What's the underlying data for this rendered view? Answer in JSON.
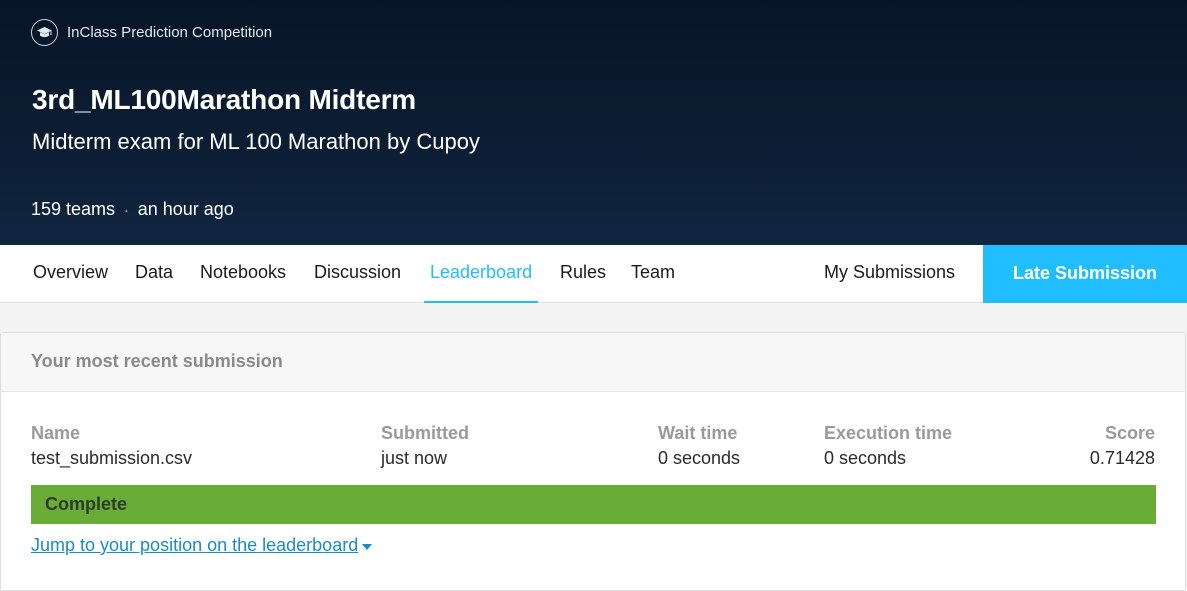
{
  "header": {
    "competition_type": "InClass Prediction Competition",
    "title": "3rd_ML100Marathon Midterm",
    "subtitle": "Midterm exam for ML 100 Marathon by Cupoy",
    "teams": "159 teams",
    "separator": "·",
    "updated": "an hour ago",
    "icon": "graduation-cap-icon"
  },
  "tabs": {
    "overview": "Overview",
    "data": "Data",
    "notebooks": "Notebooks",
    "discussion": "Discussion",
    "leaderboard": "Leaderboard",
    "rules": "Rules",
    "team": "Team",
    "active": "Leaderboard"
  },
  "actions": {
    "my_submissions": "My Submissions",
    "late_submission": "Late Submission"
  },
  "submission": {
    "heading": "Your most recent submission",
    "columns": {
      "name": "Name",
      "submitted": "Submitted",
      "wait_time": "Wait time",
      "execution_time": "Execution time",
      "score": "Score"
    },
    "values": {
      "name": "test_submission.csv",
      "submitted": "just now",
      "wait_time": "0 seconds",
      "execution_time": "0 seconds",
      "score": "0.71428"
    },
    "status": "Complete",
    "jump_link": "Jump to your position on the leaderboard"
  },
  "colors": {
    "header_bg": "#0c1d33",
    "accent": "#20beff",
    "complete_green": "#6aad36",
    "link": "#1a8cc9"
  }
}
